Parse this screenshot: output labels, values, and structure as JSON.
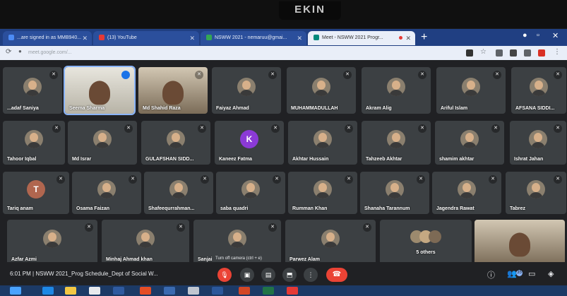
{
  "monitor": {
    "brand": "EKIN"
  },
  "browser": {
    "tabs": [
      {
        "title": "...are signed in as MMB940...",
        "active": false
      },
      {
        "title": "(13) YouTube",
        "active": false
      },
      {
        "title": "NSWW 2021 - nemaruu@gmai...",
        "active": false
      },
      {
        "title": "Meet - NSWW 2021 Progr...",
        "active": true
      }
    ],
    "url": "meet.google.com/..."
  },
  "participants": [
    {
      "name": "...adaf Saniya",
      "icon": "avatar-icon",
      "kind": "avatar"
    },
    {
      "name": "Seema Sharma",
      "icon": "video-icon",
      "kind": "video",
      "speaking": true
    },
    {
      "name": "Md Shahid Raza",
      "icon": "video-icon",
      "kind": "video"
    },
    {
      "name": "Faiyaz Ahmad",
      "icon": "avatar-icon",
      "kind": "avatar"
    },
    {
      "name": "MUHAMMADULLAH",
      "icon": "avatar-icon",
      "kind": "avatar"
    },
    {
      "name": "Akram Alig",
      "icon": "avatar-icon",
      "kind": "avatar"
    },
    {
      "name": "Ariful Islam",
      "icon": "avatar-icon",
      "kind": "avatar"
    },
    {
      "name": "AFSANA SIDDI...",
      "icon": "avatar-icon",
      "kind": "avatar"
    },
    {
      "name": "Tahoor Iqbal",
      "icon": "avatar-icon",
      "kind": "avatar"
    },
    {
      "name": "Md Israr",
      "icon": "avatar-icon",
      "kind": "avatar"
    },
    {
      "name": "GULAFSHAN SIDD...",
      "icon": "avatar-icon",
      "kind": "avatar"
    },
    {
      "name": "Kaneez Fatma",
      "icon": "avatar-icon",
      "kind": "letter",
      "letter": "K",
      "color": "#8b3ad6"
    },
    {
      "name": "Akhtar Hussain",
      "icon": "avatar-icon",
      "kind": "avatar"
    },
    {
      "name": "Tahzeeb Akhtar",
      "icon": "avatar-icon",
      "kind": "avatar"
    },
    {
      "name": "shamim akhtar",
      "icon": "avatar-icon",
      "kind": "avatar"
    },
    {
      "name": "Ishrat Jahan",
      "icon": "avatar-icon",
      "kind": "avatar"
    },
    {
      "name": "Tariq anam",
      "icon": "avatar-icon",
      "kind": "letter",
      "letter": "T",
      "color": "#b0664f"
    },
    {
      "name": "Osama Faizan",
      "icon": "avatar-icon",
      "kind": "avatar"
    },
    {
      "name": "Shafeequrrahman...",
      "icon": "avatar-icon",
      "kind": "avatar"
    },
    {
      "name": "saba quadri",
      "icon": "avatar-icon",
      "kind": "avatar"
    },
    {
      "name": "Rumman Khan",
      "icon": "avatar-icon",
      "kind": "avatar"
    },
    {
      "name": "Shanaha Tarannum",
      "icon": "avatar-icon",
      "kind": "avatar"
    },
    {
      "name": "Jagendra Rawat",
      "icon": "avatar-icon",
      "kind": "avatar"
    },
    {
      "name": "Tabrez",
      "icon": "avatar-icon",
      "kind": "avatar"
    },
    {
      "name": "Azfar Azmi",
      "icon": "avatar-icon",
      "kind": "avatar"
    },
    {
      "name": "Minhaj Ahmad khan",
      "icon": "avatar-icon",
      "kind": "avatar"
    },
    {
      "name": "Sanjai Bhatt",
      "icon": "avatar-icon",
      "kind": "avatar"
    },
    {
      "name": "Parwez Alam",
      "icon": "avatar-icon",
      "kind": "avatar"
    },
    {
      "name": "5 others",
      "icon": "group-icon",
      "kind": "others"
    },
    {
      "name": "",
      "icon": "video-icon",
      "kind": "self-video"
    }
  ],
  "bottombar": {
    "time": "6:01 PM",
    "separator": "|",
    "meeting_title": "NSWW 2021_Prog Schedule_Dept of Social W...",
    "tooltip": "Turn off camera (ctrl + e)",
    "participant_count": "35"
  },
  "colors": {
    "meet_bg": "#202124",
    "tile_bg": "#3c4043",
    "end_call": "#ea4335",
    "accent": "#8ab4f8"
  }
}
